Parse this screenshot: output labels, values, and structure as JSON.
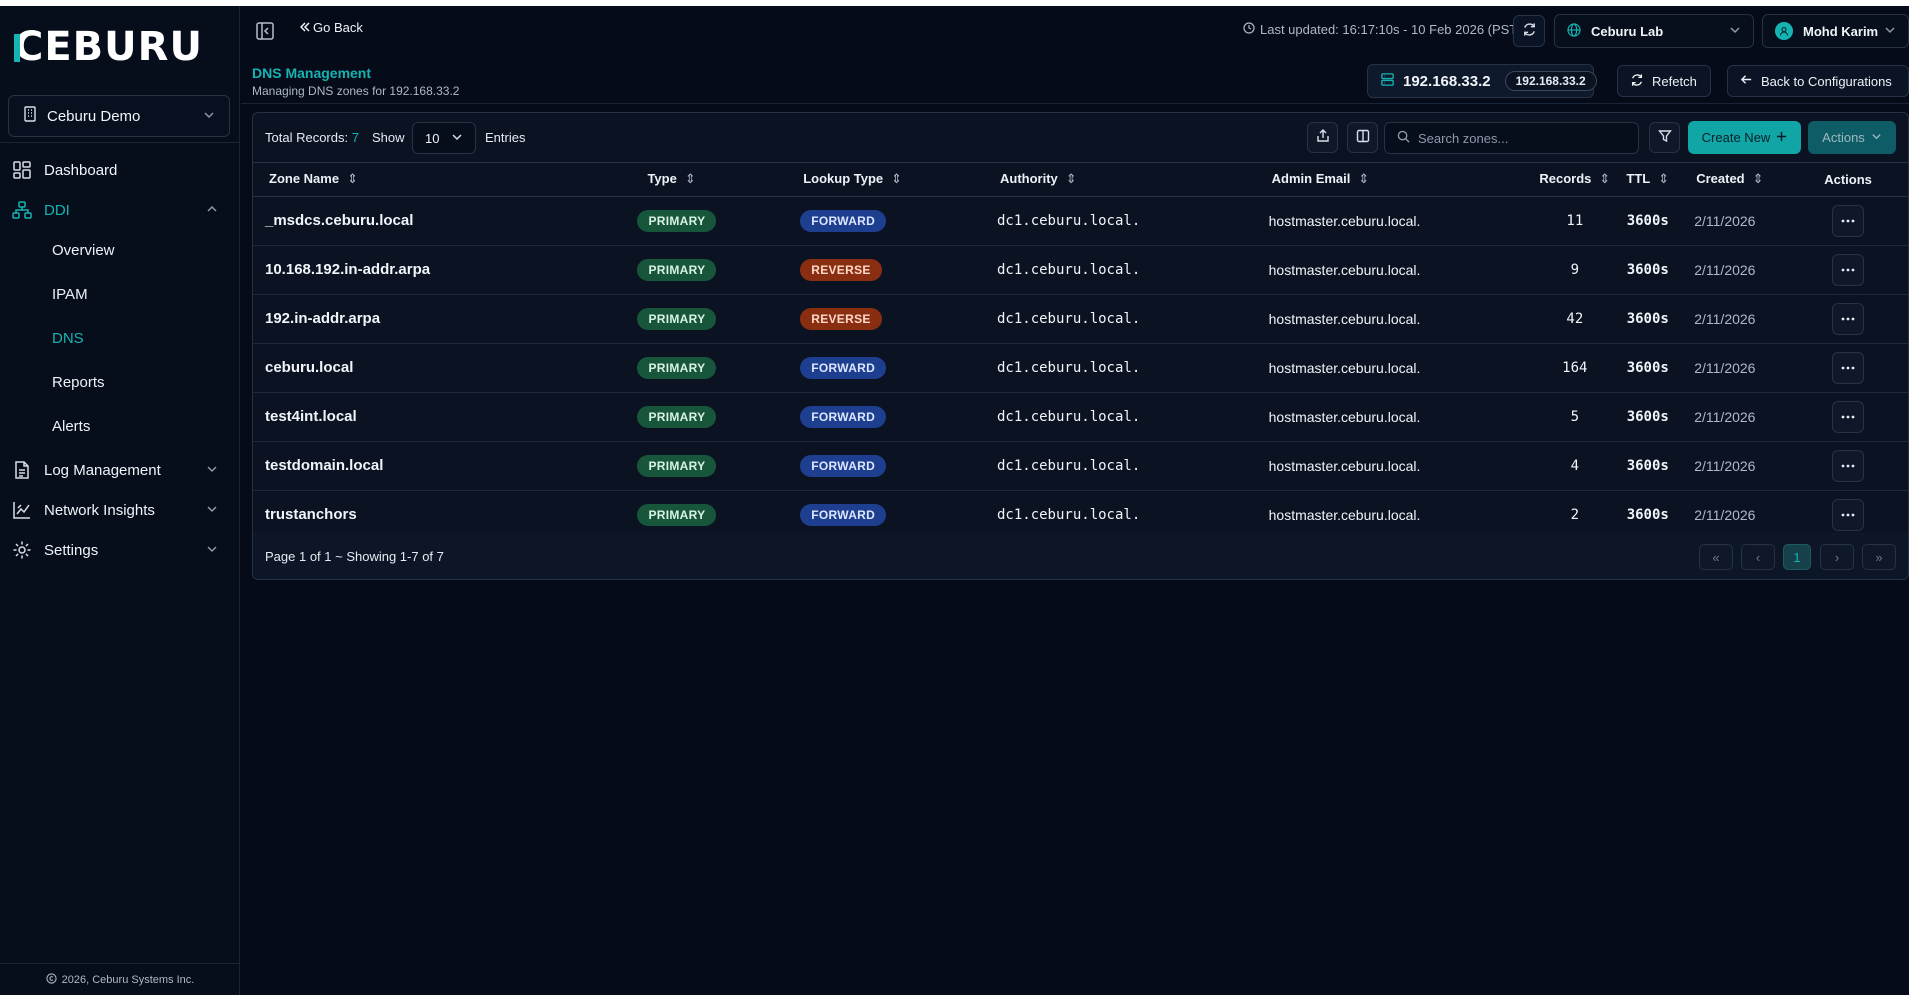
{
  "brand": {
    "logo": "CEBURU",
    "accent": "#16b3b3"
  },
  "org_selector": {
    "value": "Ceburu Demo"
  },
  "sidebar": {
    "items": [
      {
        "label": "Dashboard",
        "icon": "dashboard-icon"
      },
      {
        "label": "DDI",
        "icon": "network-tree-icon",
        "expanded": true,
        "children": [
          {
            "label": "Overview"
          },
          {
            "label": "IPAM"
          },
          {
            "label": "DNS",
            "active": true
          },
          {
            "label": "Reports"
          },
          {
            "label": "Alerts"
          }
        ]
      },
      {
        "label": "Log Management",
        "icon": "file-text-icon"
      },
      {
        "label": "Network Insights",
        "icon": "chart-icon"
      },
      {
        "label": "Settings",
        "icon": "gear-icon"
      }
    ],
    "footer": "2026, Ceburu Systems Inc."
  },
  "topbar": {
    "go_back": "Go Back",
    "last_updated": "Last updated: 16:17:10s - 10 Feb 2026 (PST)",
    "site_select": "Ceburu Lab",
    "user": "Mohd Karim"
  },
  "page": {
    "title": "DNS Management",
    "subtitle": "Managing DNS zones for 192.168.33.2",
    "server_ip": "192.168.33.2",
    "server_pill": "192.168.33.2",
    "refetch": "Refetch",
    "back": "Back to Configurations"
  },
  "toolbar": {
    "total_label": "Total Records:",
    "total_value": "7",
    "show_label": "Show",
    "page_size": "10",
    "entries_label": "Entries",
    "search_placeholder": "Search zones...",
    "create_label": "Create New",
    "actions_label": "Actions"
  },
  "table": {
    "columns": [
      "Zone Name",
      "Type",
      "Lookup Type",
      "Authority",
      "Admin Email",
      "Records",
      "TTL",
      "Created",
      "Actions"
    ],
    "rows": [
      {
        "zone": "_msdcs.ceburu.local",
        "type": "PRIMARY",
        "lookup": "FORWARD",
        "authority": "dc1.ceburu.local.",
        "email": "hostmaster.ceburu.local.",
        "records": "11",
        "ttl": "3600s",
        "created": "2/11/2026"
      },
      {
        "zone": "10.168.192.in-addr.arpa",
        "type": "PRIMARY",
        "lookup": "REVERSE",
        "authority": "dc1.ceburu.local.",
        "email": "hostmaster.ceburu.local.",
        "records": "9",
        "ttl": "3600s",
        "created": "2/11/2026"
      },
      {
        "zone": "192.in-addr.arpa",
        "type": "PRIMARY",
        "lookup": "REVERSE",
        "authority": "dc1.ceburu.local.",
        "email": "hostmaster.ceburu.local.",
        "records": "42",
        "ttl": "3600s",
        "created": "2/11/2026"
      },
      {
        "zone": "ceburu.local",
        "type": "PRIMARY",
        "lookup": "FORWARD",
        "authority": "dc1.ceburu.local.",
        "email": "hostmaster.ceburu.local.",
        "records": "164",
        "ttl": "3600s",
        "created": "2/11/2026"
      },
      {
        "zone": "test4int.local",
        "type": "PRIMARY",
        "lookup": "FORWARD",
        "authority": "dc1.ceburu.local.",
        "email": "hostmaster.ceburu.local.",
        "records": "5",
        "ttl": "3600s",
        "created": "2/11/2026"
      },
      {
        "zone": "testdomain.local",
        "type": "PRIMARY",
        "lookup": "FORWARD",
        "authority": "dc1.ceburu.local.",
        "email": "hostmaster.ceburu.local.",
        "records": "4",
        "ttl": "3600s",
        "created": "2/11/2026"
      },
      {
        "zone": "trustanchors",
        "type": "PRIMARY",
        "lookup": "FORWARD",
        "authority": "dc1.ceburu.local.",
        "email": "hostmaster.ceburu.local.",
        "records": "2",
        "ttl": "3600s",
        "created": "2/11/2026"
      }
    ]
  },
  "pagination": {
    "summary": "Page 1 of 1 ~ Showing 1-7 of 7",
    "current": "1"
  }
}
